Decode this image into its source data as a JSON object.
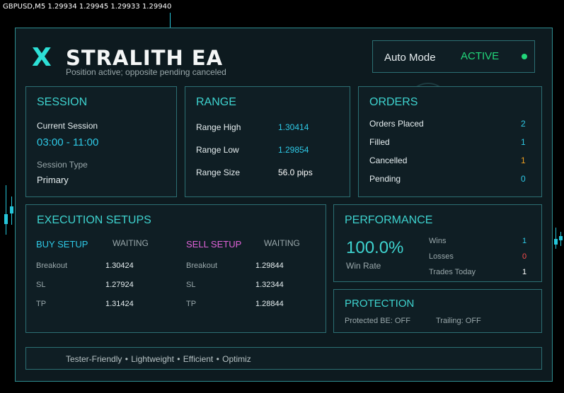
{
  "chart": {
    "header": "GBPUSD,M5  1.29934 1.29945 1.29933 1.29940"
  },
  "brand": {
    "logo": "X",
    "title": "STRALITH EA",
    "subtitle": "Position active; opposite pending canceled"
  },
  "auto_mode": {
    "label": "Auto Mode",
    "status": "ACTIVE",
    "status_color": "#22d67a"
  },
  "session": {
    "title": "SESSION",
    "current_label": "Current Session",
    "current_value": "03:00 - 11:00",
    "type_label": "Session Type",
    "type_value": "Primary"
  },
  "range": {
    "title": "RANGE",
    "high_label": "Range High",
    "high_value": "1.30414",
    "low_label": "Range Low",
    "low_value": "1.29854",
    "size_label": "Range Size",
    "size_value": "56.0 pips"
  },
  "orders": {
    "title": "ORDERS",
    "placed_label": "Orders Placed",
    "placed_value": "2",
    "filled_label": "Filled",
    "filled_value": "1",
    "cancelled_label": "Cancelled",
    "cancelled_value": "1",
    "pending_label": "Pending",
    "pending_value": "0"
  },
  "execution": {
    "title": "EXECUTION SETUPS",
    "buy": {
      "label": "BUY SETUP",
      "status": "WAITING",
      "breakout_label": "Breakout",
      "breakout_value": "1.30424",
      "sl_label": "SL",
      "sl_value": "1.27924",
      "tp_label": "TP",
      "tp_value": "1.31424",
      "color": "#2ec9e6"
    },
    "sell": {
      "label": "SELL SETUP",
      "status": "WAITING",
      "breakout_label": "Breakout",
      "breakout_value": "1.29844",
      "sl_label": "SL",
      "sl_value": "1.32344",
      "tp_label": "TP",
      "tp_value": "1.28844",
      "color": "#e062d8"
    }
  },
  "performance": {
    "title": "PERFORMANCE",
    "win_rate_value": "100.0%",
    "win_rate_label": "Win Rate",
    "wins_label": "Wins",
    "wins_value": "1",
    "losses_label": "Losses",
    "losses_value": "0",
    "trades_label": "Trades Today",
    "trades_value": "1"
  },
  "protection": {
    "title": "PROTECTION",
    "be_text": "Protected BE: OFF",
    "trailing_text": "Trailing: OFF"
  },
  "footer": {
    "text": "Tester-Friendly  •  Lightweight  •  Efficient  •  Optimiz"
  },
  "colors": {
    "accent": "#3ed3cf",
    "value_cyan": "#2ec9e6",
    "value_orange": "#f0a020",
    "value_red": "#ff4c4c",
    "value_white": "#ffffff",
    "border": "#2c6f73"
  }
}
